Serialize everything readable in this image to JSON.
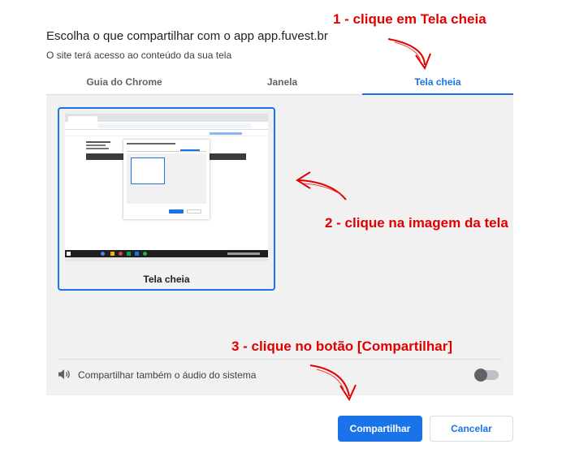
{
  "dialog": {
    "title": "Escolha o que compartilhar com o app app.fuvest.br",
    "subtitle": "O site terá acesso ao conteúdo da sua tela"
  },
  "tabs": [
    {
      "label": "Guia do Chrome",
      "active": false
    },
    {
      "label": "Janela",
      "active": false
    },
    {
      "label": "Tela cheia",
      "active": true
    }
  ],
  "screen_option": {
    "label": "Tela cheia",
    "selected": true
  },
  "audio": {
    "label": "Compartilhar também o áudio do sistema",
    "enabled": false,
    "icon": "speaker-icon"
  },
  "buttons": {
    "share": "Compartilhar",
    "cancel": "Cancelar"
  },
  "annotations": {
    "step1": "1 - clique em Tela cheia",
    "step2": "2 - clique na imagem da tela",
    "step3": "3 - clique no botão [Compartilhar]",
    "color": "#e00000"
  },
  "colors": {
    "accent": "#1a73e8",
    "panel": "#f1f1f1",
    "annotation": "#e00000"
  }
}
